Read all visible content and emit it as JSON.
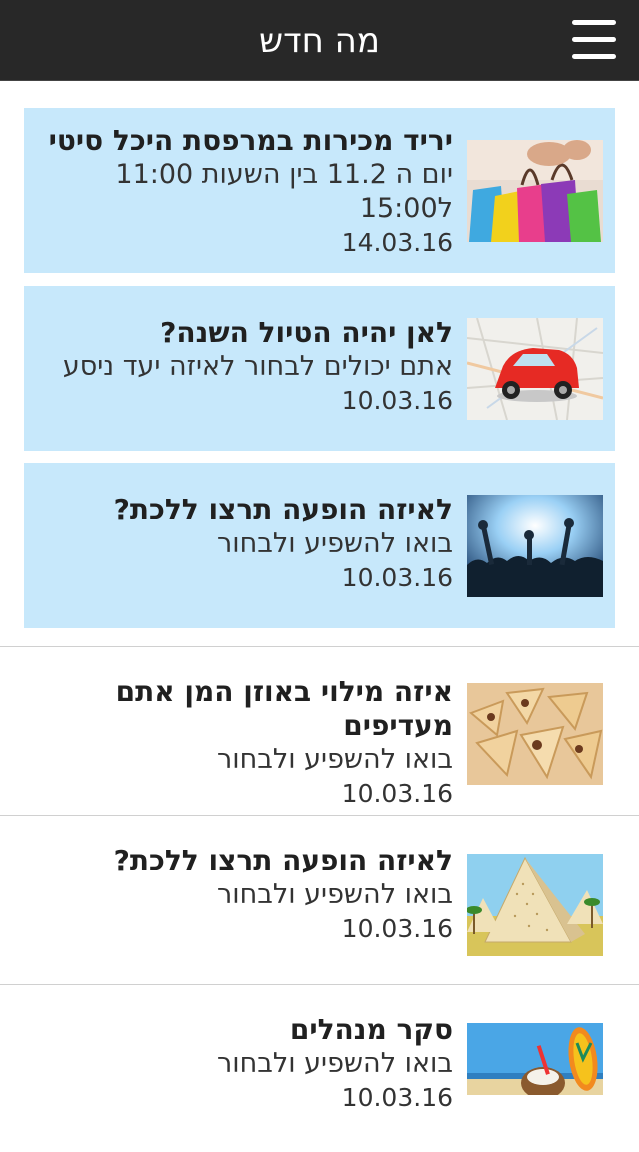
{
  "header": {
    "title": "מה חדש",
    "menu_icon": "hamburger-menu-icon"
  },
  "items": [
    {
      "title": "יריד מכירות במרפסת היכל סיטי",
      "desc": "יום ה 11.2 בין השעות 11:00 ל15:00",
      "date": "14.03.16",
      "featured": true,
      "image": "shopping-bags"
    },
    {
      "title": "לאן יהיה הטיול השנה?",
      "desc": "אתם יכולים לבחור לאיזה יעד ניסע",
      "date": "10.03.16",
      "featured": true,
      "image": "red-car-on-map"
    },
    {
      "title": "לאיזה הופעה תרצו ללכת?",
      "desc": "בואו להשפיע ולבחור",
      "date": "10.03.16",
      "featured": true,
      "image": "concert-crowd"
    },
    {
      "title": "איזה מילוי באוזן המן אתם מעדיפים",
      "desc": "בואו להשפיע ולבחור",
      "date": "10.03.16",
      "featured": false,
      "image": "hamantaschen-pastries"
    },
    {
      "title": "לאיזה הופעה תרצו ללכת?",
      "desc": "בואו להשפיע ולבחור",
      "date": "10.03.16",
      "featured": false,
      "image": "matzah-pyramids"
    },
    {
      "title": "סקר מנהלים",
      "desc": "בואו להשפיע ולבחור",
      "date": "10.03.16",
      "featured": false,
      "image": "beach-coconut-flipflops"
    }
  ]
}
